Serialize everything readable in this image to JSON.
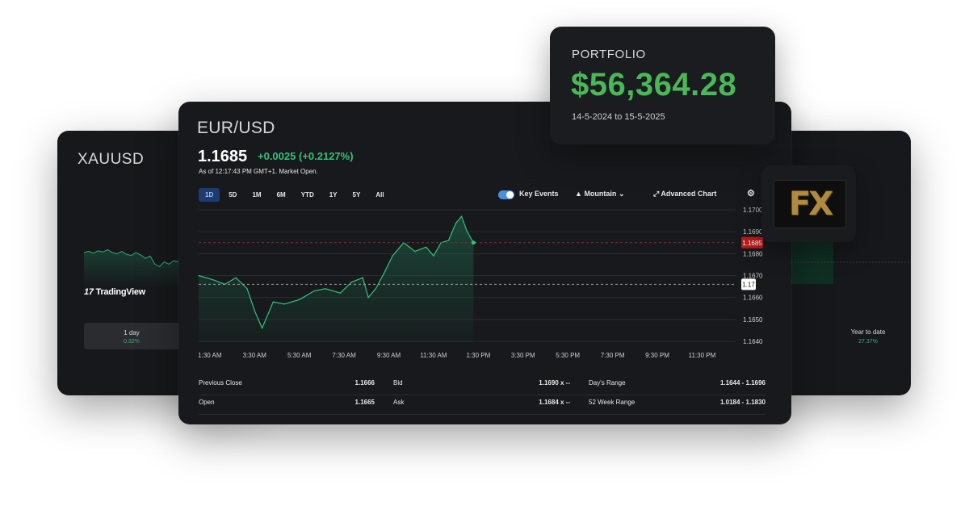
{
  "left_card": {
    "symbol": "XAUUSD",
    "watermark": "TradingView",
    "stat_label": "1 day",
    "stat_value": "0.32%"
  },
  "right_card": {
    "stat_label": "Year to date",
    "stat_value": "27.37%"
  },
  "main": {
    "pair": "EUR/USD",
    "price": "1.1685",
    "change": "+0.0025",
    "change_pct": "(+0.2127%)",
    "as_of": "As of 12:17:43 PM GMT+1. Market Open.",
    "ranges": [
      "1D",
      "5D",
      "1M",
      "6M",
      "YTD",
      "1Y",
      "5Y",
      "All"
    ],
    "active_range": "1D",
    "key_events_label": "Key Events",
    "mountain_label": "Mountain",
    "advanced_chart_label": "Advanced Chart",
    "colors": {
      "up": "#34c27b",
      "current_price_tag": "#b71c1c",
      "accent": "#4a90e2"
    }
  },
  "chart_data": {
    "type": "area",
    "x_labels": [
      "1:30 AM",
      "3:30 AM",
      "5:30 AM",
      "7:30 AM",
      "9:30 AM",
      "11:30 AM",
      "1:30 PM",
      "3:30 PM",
      "5:30 PM",
      "7:30 PM",
      "9:30 PM",
      "11:30 PM"
    ],
    "y_ticks": [
      "1.1700",
      "1.1690",
      "1.1680",
      "1.1670",
      "1.1660",
      "1.1650",
      "1.1640"
    ],
    "ylim": [
      1.164,
      1.17
    ],
    "current_price_label": "1.1685",
    "previous_close_label": "1.17",
    "previous_close": 1.1666,
    "current_price": 1.1685,
    "series": [
      {
        "x": [
          "00:00",
          "00:40",
          "01:10",
          "01:40",
          "02:10",
          "02:30",
          "02:50",
          "03:20",
          "03:50",
          "04:30",
          "05:10",
          "05:40",
          "06:20",
          "06:50",
          "07:20",
          "07:35",
          "07:55",
          "08:20",
          "08:40",
          "09:10",
          "09:40",
          "10:10",
          "10:30",
          "10:50",
          "11:10",
          "11:30",
          "11:45",
          "12:00",
          "12:17"
        ],
        "values": [
          1.167,
          1.1668,
          1.1666,
          1.1669,
          1.1664,
          1.1654,
          1.1646,
          1.1658,
          1.1657,
          1.1659,
          1.1663,
          1.1664,
          1.1662,
          1.1667,
          1.1669,
          1.166,
          1.1664,
          1.1672,
          1.1679,
          1.1685,
          1.1681,
          1.1683,
          1.1679,
          1.1685,
          1.1686,
          1.1694,
          1.1697,
          1.169,
          1.1685
        ]
      }
    ],
    "grid": true
  },
  "stats": {
    "previous_close_label": "Previous Close",
    "previous_close_value": "1.1666",
    "open_label": "Open",
    "open_value": "1.1665",
    "bid_label": "Bid",
    "bid_value": "1.1690 x --",
    "ask_label": "Ask",
    "ask_value": "1.1684 x --",
    "days_range_label": "Day's Range",
    "days_range_value": "1.1644 - 1.1696",
    "week52_label": "52 Week Range",
    "week52_value": "1.0184 - 1.1830"
  },
  "portfolio": {
    "label": "PORTFOLIO",
    "value": "$56,364.28",
    "period": "14-5-2024  to 15-5-2025"
  },
  "fx_badge": {
    "text": "FX"
  }
}
